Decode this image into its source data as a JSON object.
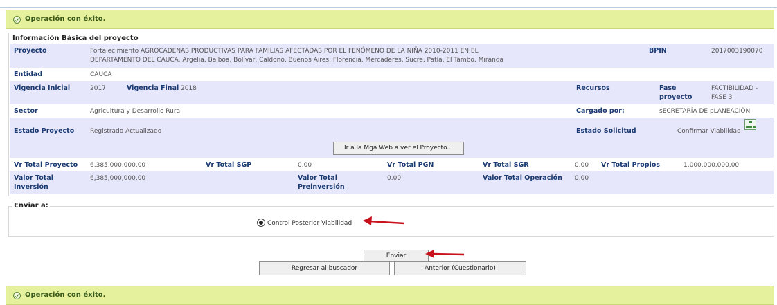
{
  "top_banner": {
    "message": "Operación con éxito."
  },
  "bottom_banner": {
    "message": "Operación con éxito."
  },
  "project": {
    "section_title": "Información Básica del proyecto",
    "proyecto_label": "Proyecto",
    "proyecto_line1": "Fortalecimiento AGROCADENAS PRODUCTIVAS PARA FAMILIAS AFECTADAS POR EL FENÓMENO DE LA NIÑA 2010-2011 EN EL",
    "proyecto_line2": "DEPARTAMENTO DEL CAUCA. Argelia, Balboa, Bolívar, Caldono, Buenos Aires, Florencia, Mercaderes, Sucre, Patía, El Tambo, Miranda",
    "bpin_label": "BPIN",
    "bpin_value": "2017003190070",
    "entidad_label": "Entidad",
    "entidad_value": "CAUCA",
    "vig_ini_label": "Vigencia Inicial",
    "vig_ini_value": "2017",
    "vig_fin_label": "Vigencia Final",
    "vig_fin_value": "2018",
    "recursos_label": "Recursos",
    "fase_label_1": "Fase",
    "fase_label_2": "proyecto",
    "fase_value_1": "FACTIBILIDAD -",
    "fase_value_2": "FASE 3",
    "sector_label": "Sector",
    "sector_value": "Agricultura y Desarrollo Rural",
    "cargado_label": "Cargado por:",
    "cargado_value": "sECRETARÍA DE pLANEACIÓN",
    "estado_proy_label": "Estado Proyecto",
    "estado_proy_value": "Registrado Actualizado",
    "estado_sol_label": "Estado Solicitud",
    "estado_sol_value": "Confirmar Viabilidad",
    "mga_button": "Ir a la Mga Web a ver el Proyecto...",
    "vr_total_proyecto_label": "Vr Total Proyecto",
    "vr_total_proyecto_value": "6,385,000,000.00",
    "vr_total_sgp_label": "Vr Total SGP",
    "vr_total_sgp_value": "0.00",
    "vr_total_pgn_label": "Vr Total PGN",
    "vr_total_sgr_label": "Vr Total SGR",
    "vr_total_sgr_value": "0.00",
    "vr_total_propios_label": "Vr Total Propios",
    "vr_total_propios_value": "1,000,000,000.00",
    "valor_inversion_label_1": "Valor Total",
    "valor_inversion_label_2": "Inversión",
    "valor_inversion_value": "6,385,000,000.00",
    "valor_preinversion_label_1": "Valor Total",
    "valor_preinversion_label_2": "Preinversión",
    "valor_preinversion_value": "0.00",
    "valor_operacion_label": "Valor Total Operación",
    "valor_operacion_value": "0.00"
  },
  "send": {
    "legend": "Enviar a:",
    "option_label": "Control Posterior Viabilidad",
    "option_selected": true,
    "send_button": "Enviar",
    "back_button": "Regresar al buscador",
    "prev_button": "Anterior (Cuestionario)"
  },
  "colors": {
    "banner_bg": "#e5f19c",
    "label_blue": "#1a3a72",
    "row_shade": "#e7e7fb",
    "arrow_red": "#c8121c"
  },
  "icons": [
    "success-check-icon",
    "hierarchy-tree-icon",
    "annotation-arrow-icon"
  ]
}
